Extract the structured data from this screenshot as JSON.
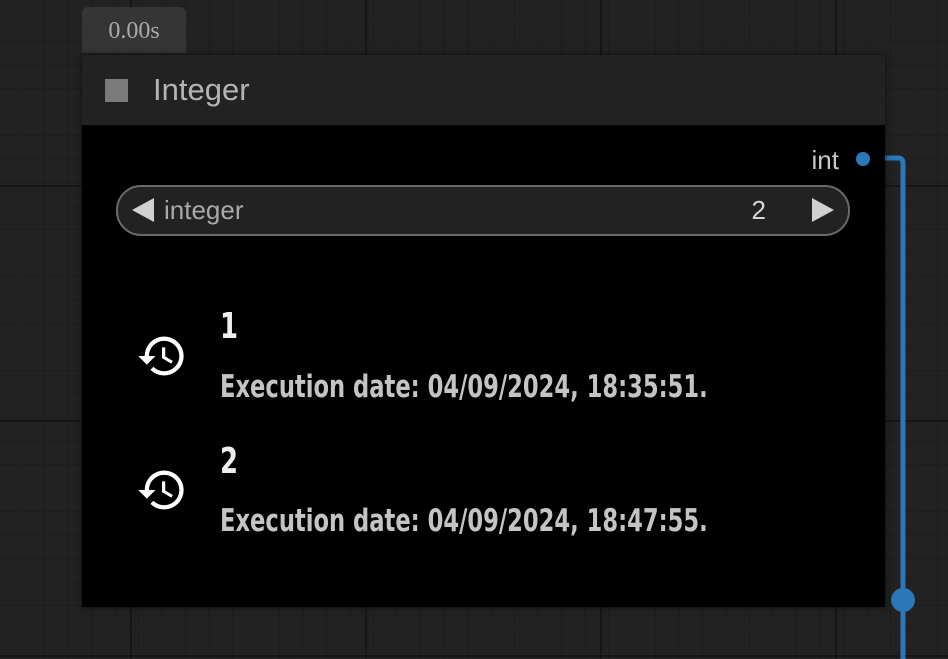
{
  "timer": "0.00s",
  "node": {
    "title": "Integer",
    "output_label": "int",
    "widget": {
      "label": "integer",
      "value": "2"
    },
    "history": [
      {
        "value": "1",
        "date": "Execution date: 04/09/2024, 18:35:51."
      },
      {
        "value": "2",
        "date": "Execution date: 04/09/2024, 18:47:55."
      }
    ]
  },
  "colors": {
    "link": "#2a78b8",
    "node_bg": "#000000",
    "header_bg": "#222222",
    "canvas_bg": "#222222"
  },
  "icons": {
    "history": "history-icon",
    "collapse": "collapse-square-icon",
    "decrement": "arrow-left-icon",
    "increment": "arrow-right-icon"
  }
}
